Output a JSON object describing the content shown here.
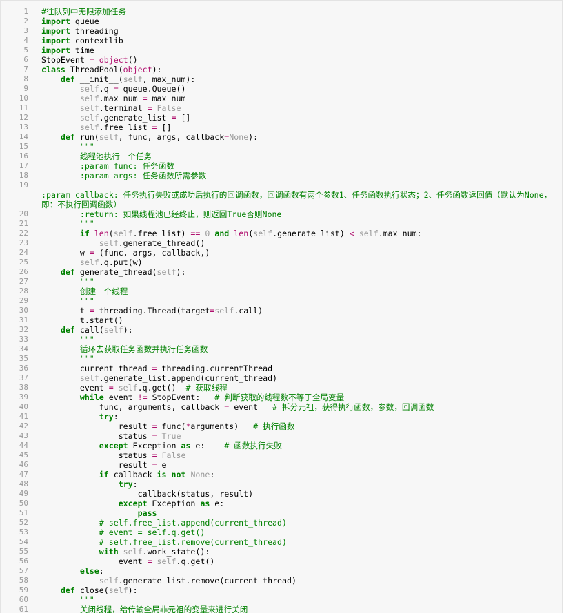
{
  "code": {
    "language": "python",
    "lines": [
      {
        "n": "1",
        "text": "#往队列中无限添加任务"
      },
      {
        "n": "2",
        "text": "import queue"
      },
      {
        "n": "3",
        "text": "import threading"
      },
      {
        "n": "4",
        "text": "import contextlib"
      },
      {
        "n": "5",
        "text": "import time"
      },
      {
        "n": "6",
        "text": "StopEvent = object()"
      },
      {
        "n": "7",
        "text": "class ThreadPool(object):"
      },
      {
        "n": "8",
        "text": "    def __init__(self, max_num):"
      },
      {
        "n": "9",
        "text": "        self.q = queue.Queue()"
      },
      {
        "n": "10",
        "text": "        self.max_num = max_num"
      },
      {
        "n": "11",
        "text": "        self.terminal = False"
      },
      {
        "n": "12",
        "text": "        self.generate_list = []"
      },
      {
        "n": "13",
        "text": "        self.free_list = []"
      },
      {
        "n": "14",
        "text": "    def run(self, func, args, callback=None):"
      },
      {
        "n": "15",
        "text": "        \"\"\""
      },
      {
        "n": "16",
        "text": "        线程池执行一个任务"
      },
      {
        "n": "17",
        "text": "        :param func: 任务函数"
      },
      {
        "n": "18",
        "text": "        :param args: 任务函数所需参数"
      },
      {
        "n": "19",
        "text": "\n:param callback: 任务执行失败或成功后执行的回调函数，回调函数有两个参数1、任务函数执行状态；2、任务函数返回值（默认为None，即：不执行回调函数）"
      },
      {
        "n": "20",
        "text": "        :return: 如果线程池已经终止，则返回True否则None"
      },
      {
        "n": "21",
        "text": "        \"\"\""
      },
      {
        "n": "22",
        "text": "        if len(self.free_list) == 0 and len(self.generate_list) < self.max_num:"
      },
      {
        "n": "23",
        "text": "            self.generate_thread()"
      },
      {
        "n": "24",
        "text": "        w = (func, args, callback,)"
      },
      {
        "n": "25",
        "text": "        self.q.put(w)"
      },
      {
        "n": "26",
        "text": "    def generate_thread(self):"
      },
      {
        "n": "27",
        "text": "        \"\"\""
      },
      {
        "n": "28",
        "text": "        创建一个线程"
      },
      {
        "n": "29",
        "text": "        \"\"\""
      },
      {
        "n": "30",
        "text": "        t = threading.Thread(target=self.call)"
      },
      {
        "n": "31",
        "text": "        t.start()"
      },
      {
        "n": "32",
        "text": "    def call(self):"
      },
      {
        "n": "33",
        "text": "        \"\"\""
      },
      {
        "n": "34",
        "text": "        循环去获取任务函数并执行任务函数"
      },
      {
        "n": "35",
        "text": "        \"\"\""
      },
      {
        "n": "36",
        "text": "        current_thread = threading.currentThread"
      },
      {
        "n": "37",
        "text": "        self.generate_list.append(current_thread)"
      },
      {
        "n": "38",
        "text": "        event = self.q.get()  # 获取线程"
      },
      {
        "n": "39",
        "text": "        while event != StopEvent:   # 判断获取的线程数不等于全局变量"
      },
      {
        "n": "40",
        "text": "            func, arguments, callback = event   # 拆分元祖，获得执行函数，参数，回调函数"
      },
      {
        "n": "41",
        "text": "            try:"
      },
      {
        "n": "42",
        "text": "                result = func(*arguments)   # 执行函数"
      },
      {
        "n": "43",
        "text": "                status = True"
      },
      {
        "n": "44",
        "text": "            except Exception as e:    # 函数执行失败"
      },
      {
        "n": "45",
        "text": "                status = False"
      },
      {
        "n": "46",
        "text": "                result = e"
      },
      {
        "n": "47",
        "text": "            if callback is not None:"
      },
      {
        "n": "48",
        "text": "                try:"
      },
      {
        "n": "49",
        "text": "                    callback(status, result)"
      },
      {
        "n": "50",
        "text": "                except Exception as e:"
      },
      {
        "n": "51",
        "text": "                    pass"
      },
      {
        "n": "52",
        "text": "            # self.free_list.append(current_thread)"
      },
      {
        "n": "53",
        "text": "            # event = self.q.get()"
      },
      {
        "n": "54",
        "text": "            # self.free_list.remove(current_thread)"
      },
      {
        "n": "55",
        "text": "            with self.work_state():"
      },
      {
        "n": "56",
        "text": "                event = self.q.get()"
      },
      {
        "n": "57",
        "text": "        else:"
      },
      {
        "n": "58",
        "text": "            self.generate_list.remove(current_thread)"
      },
      {
        "n": "59",
        "text": "    def close(self):"
      },
      {
        "n": "60",
        "text": "        \"\"\""
      },
      {
        "n": "61",
        "text": "        关闭线程，给传输全局非元祖的变量来进行关闭"
      }
    ]
  }
}
